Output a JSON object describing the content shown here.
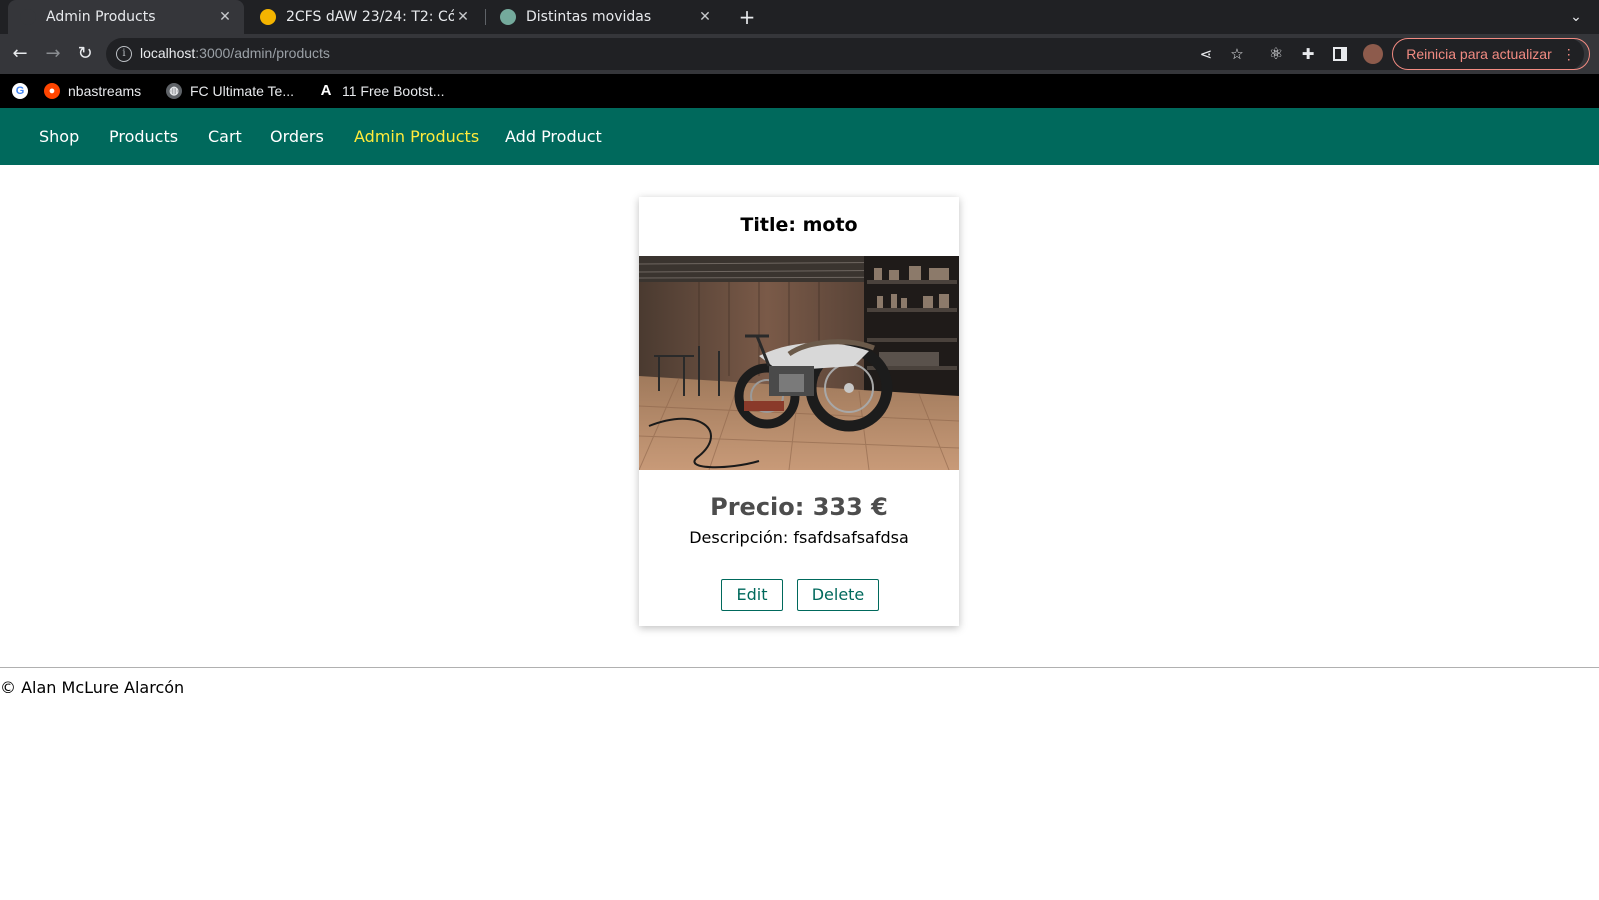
{
  "browser": {
    "tabs": [
      {
        "title": "Admin Products",
        "active": true
      },
      {
        "title": "2CFS dAW 23/24: T2: Códi",
        "active": false
      },
      {
        "title": "Distintas movidas",
        "active": false
      }
    ],
    "url_host": "localhost",
    "url_path": ":3000/admin/products",
    "update_button": "Reinicia para actualizar",
    "bookmarks": [
      {
        "label": "",
        "icon": "google-icon"
      },
      {
        "label": "nbastreams",
        "icon": "reddit-icon"
      },
      {
        "label": "FC Ultimate Te...",
        "icon": "globe-icon"
      },
      {
        "label": "11 Free Bootst...",
        "icon": "font-a-icon"
      }
    ]
  },
  "nav": {
    "items": [
      {
        "label": "Shop",
        "active": false
      },
      {
        "label": "Products",
        "active": false
      },
      {
        "label": "Cart",
        "active": false
      },
      {
        "label": "Orders",
        "active": false
      },
      {
        "label": "Admin Products",
        "active": true
      },
      {
        "label": "Add Product",
        "active": false
      }
    ]
  },
  "product": {
    "title": "Title: moto",
    "image_icon": "motorcycle-garage-photo",
    "price": "Precio: 333 €",
    "description": "Descripción: fsafdsafsafdsa",
    "edit_label": "Edit",
    "delete_label": "Delete"
  },
  "footer": {
    "text": "© Alan McLure Alarcón"
  },
  "colors": {
    "nav_bg": "#00695c",
    "nav_active": "#ffeb3b",
    "button_border": "#00695c",
    "update_accent": "#f28b82"
  }
}
